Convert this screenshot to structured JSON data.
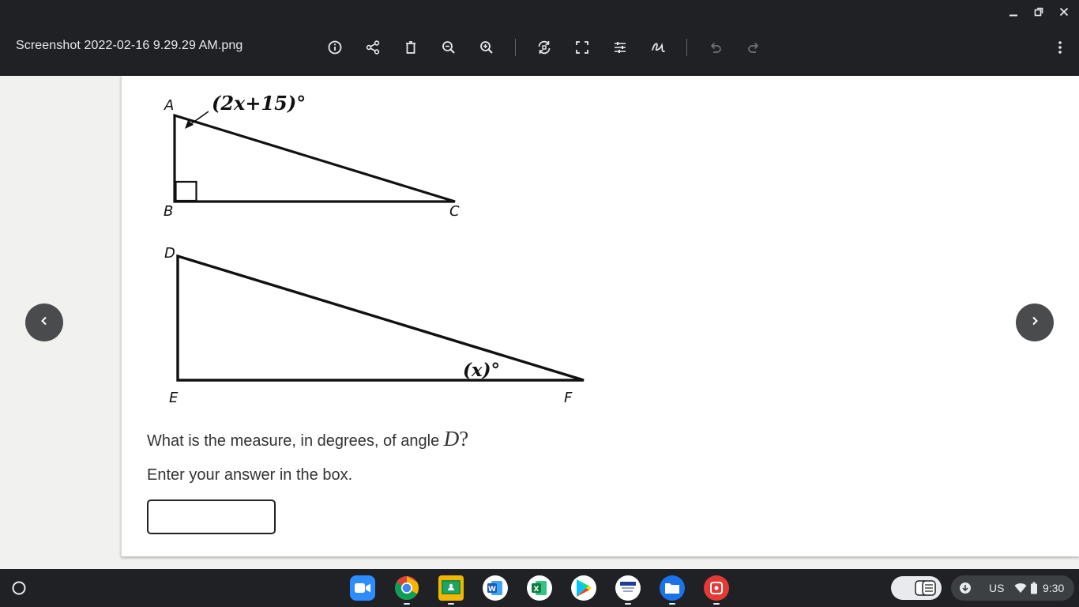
{
  "window": {
    "title": "Screenshot 2022-02-16 9.29.29 AM.png",
    "controls": [
      "minimize-icon",
      "restore-icon",
      "close-icon"
    ]
  },
  "toolbar": {
    "icons": [
      "info-icon",
      "share-icon",
      "delete-icon",
      "zoom-out-icon",
      "zoom-in-icon",
      "rotate-icon",
      "crop-icon",
      "adjust-icon",
      "annotate-icon",
      "undo-icon",
      "redo-icon",
      "more-options-icon"
    ]
  },
  "diagram": {
    "triangle_abc": {
      "vertices": [
        "A",
        "B",
        "C"
      ],
      "angle_label": "(2x+15)°",
      "right_angle_at": "B"
    },
    "triangle_def": {
      "vertices": [
        "D",
        "E",
        "F"
      ],
      "angle_label": "(x)°"
    }
  },
  "question": {
    "text": "What is the measure, in degrees, of angle ",
    "variable": "D",
    "end": "?",
    "instruction": "Enter your answer in the box.",
    "answer_value": ""
  },
  "navigation": {
    "prev_icon": "chevron-left-icon",
    "next_icon": "chevron-right-icon"
  },
  "shelf": {
    "apps": [
      "Zoom",
      "Chrome",
      "Google Classroom",
      "Word",
      "Excel",
      "Play Store",
      "Pearson TestNav",
      "Files",
      "Screencast"
    ],
    "tray": {
      "locale": "US",
      "time": "9:30"
    }
  },
  "colors": {
    "topbar": "#202124",
    "viewer_bg": "#f1f1ef",
    "nav_button": "#4a4b4d",
    "text": "#333333"
  }
}
